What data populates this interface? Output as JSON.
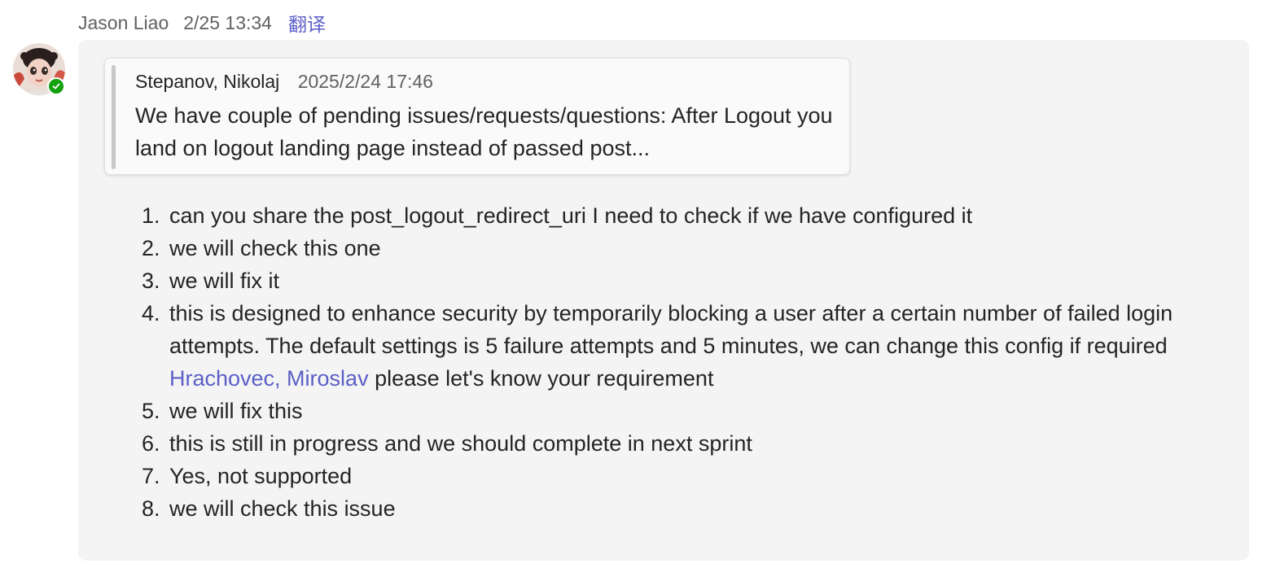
{
  "message": {
    "author": "Jason Liao",
    "timestamp": "2/25 13:34",
    "translate_label": "翻译",
    "presence": "available",
    "colors": {
      "presence": "#13a10e",
      "link": "#5b5fc7",
      "bubble": "#f4f4f4"
    }
  },
  "quote": {
    "author": "Stepanov, Nikolaj",
    "timestamp": "2025/2/24 17:46",
    "text": "We have couple of pending issues/requests/questions: After Logout you land on logout landing page instead of passed post..."
  },
  "items": [
    {
      "num": "1.",
      "text": "can you share the post_logout_redirect_uri I need to check if we have configured it"
    },
    {
      "num": "2.",
      "text": "we will check this one"
    },
    {
      "num": "3.",
      "text": "we will fix it"
    },
    {
      "num": "4.",
      "text_before": "this is designed to enhance security by temporarily blocking a user after a certain number of failed login attempts. The default settings is 5 failure attempts and 5 minutes, we can change this config if required ",
      "mention": "Hrachovec, Miroslav",
      "text_after": " please let's know your requirement"
    },
    {
      "num": "5.",
      "text": "we will fix this"
    },
    {
      "num": "6.",
      "text": "this is still in progress and we should complete in next sprint"
    },
    {
      "num": "7.",
      "text": "Yes, not supported"
    },
    {
      "num": "8.",
      "text": "we will check this issue"
    }
  ]
}
